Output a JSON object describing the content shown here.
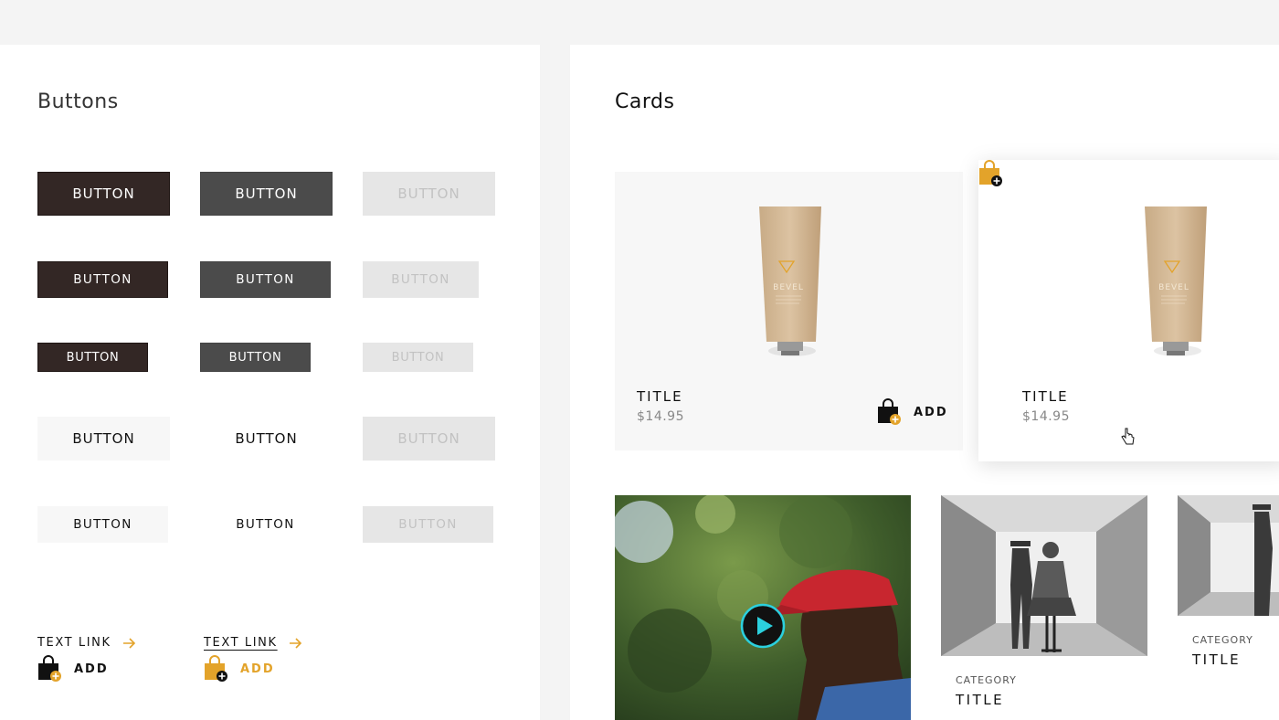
{
  "buttons_section": {
    "title": "Buttons",
    "rows": [
      [
        "BUTTON",
        "BUTTON",
        "BUTTON"
      ],
      [
        "BUTTON",
        "BUTTON",
        "BUTTON"
      ],
      [
        "BUTTON",
        "BUTTON",
        "BUTTON"
      ],
      [
        "BUTTON",
        "BUTTON",
        "BUTTON"
      ],
      [
        "BUTTON",
        "BUTTON",
        "BUTTON"
      ]
    ],
    "text_links": [
      "TEXT LINK",
      "TEXT LINK"
    ],
    "add_actions": [
      "ADD",
      "ADD"
    ]
  },
  "cards_section": {
    "title": "Cards",
    "product_cards": [
      {
        "brand": "BEVEL",
        "title": "TITLE",
        "price": "$14.95",
        "action": "ADD"
      },
      {
        "brand": "BEVEL",
        "title": "TITLE",
        "price": "$14.95"
      }
    ],
    "photo_cards": [
      {
        "category": "CATEGORY",
        "title": "TITLE"
      },
      {
        "category": "CATEGORY",
        "title": "TITLE"
      }
    ]
  },
  "colors": {
    "primary_dark": "#332725",
    "secondary_gray": "#4b4b4b",
    "disabled": "#e6e6e6",
    "accent_gold": "#e3a32a",
    "play_cyan": "#2bd0de"
  },
  "icons": [
    "arrow-right-icon",
    "shopping-bag-add-icon",
    "play-icon",
    "pointer-cursor-icon"
  ]
}
